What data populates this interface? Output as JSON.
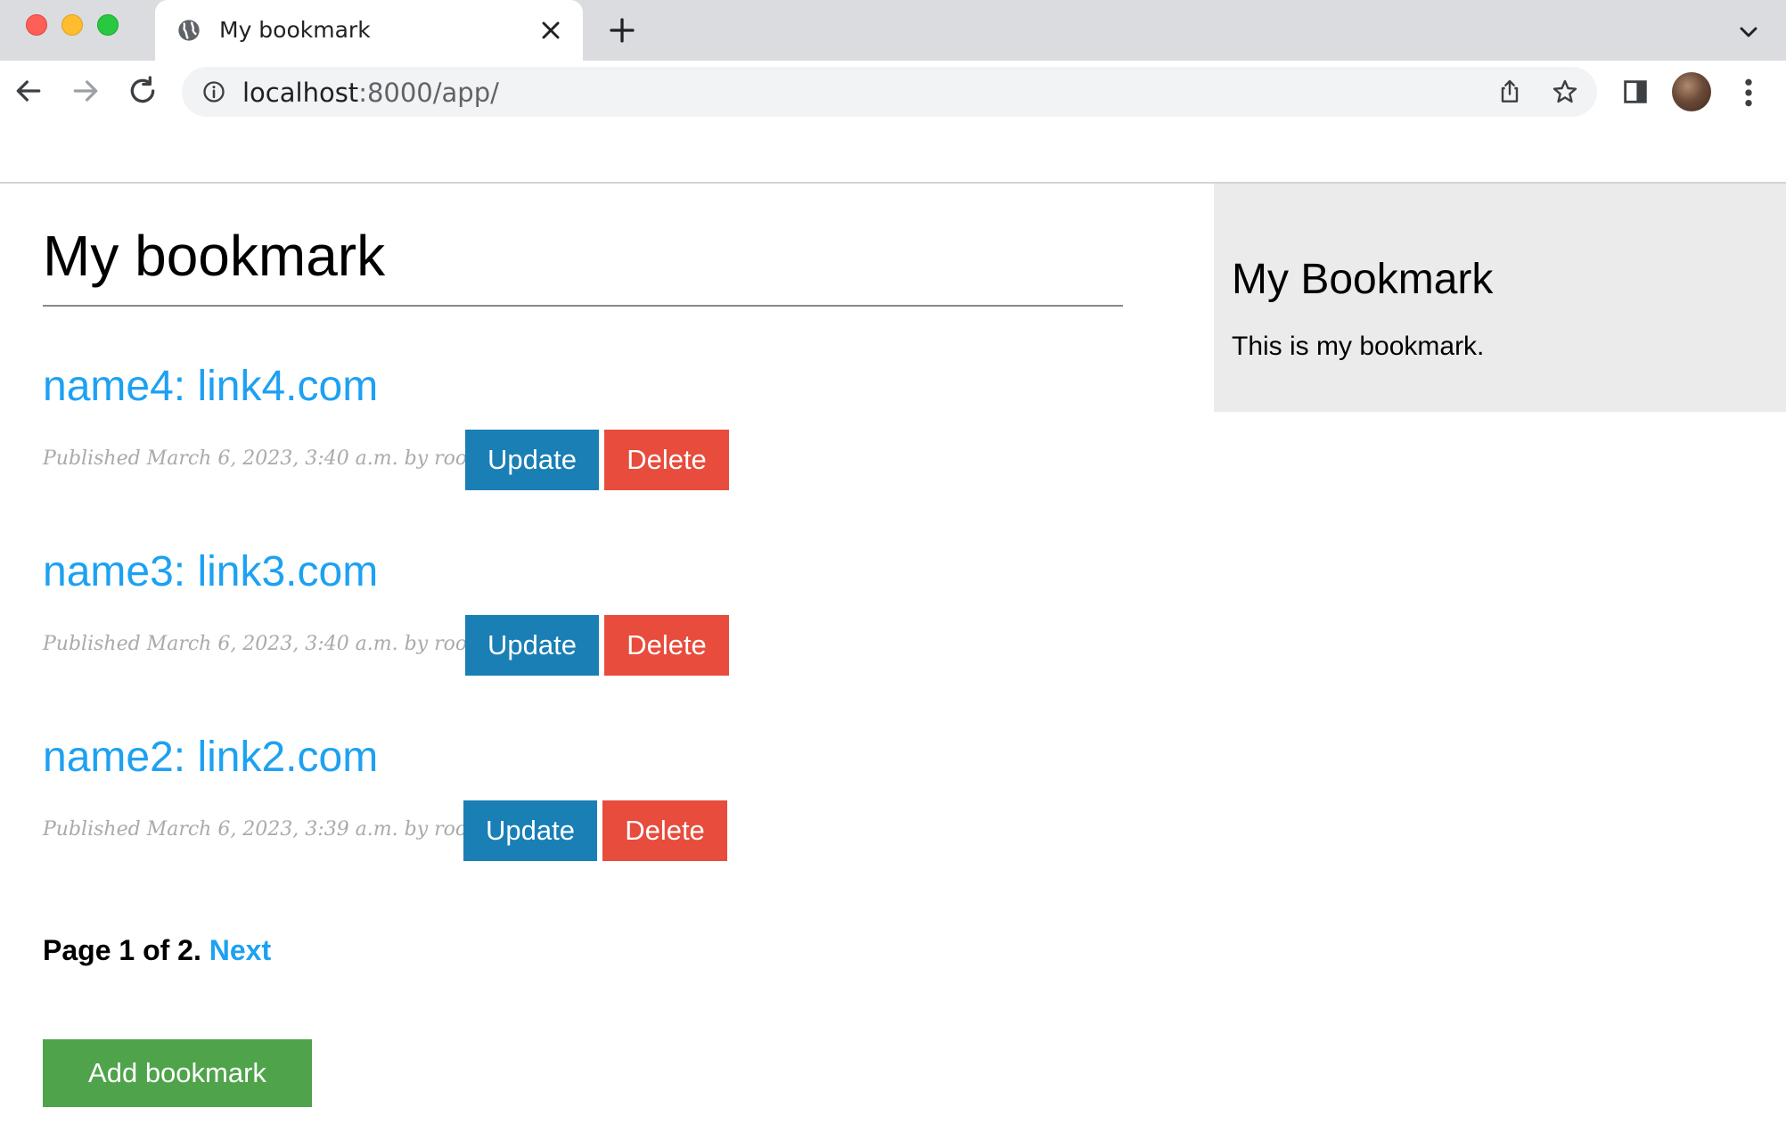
{
  "browser": {
    "tab_title": "My bookmark",
    "url_host": "localhost",
    "url_rest": ":8000/app/",
    "icons": {
      "favicon": "globe-icon",
      "tab_close": "close-icon",
      "new_tab": "plus-icon",
      "tab_search": "chevron-down-icon",
      "back": "arrow-left-icon",
      "forward": "arrow-right-icon",
      "reload": "reload-icon",
      "site_info": "info-icon",
      "share": "share-icon",
      "bookmark": "star-icon",
      "side_panel": "side-panel-icon",
      "menu": "kebab-menu-icon"
    }
  },
  "page": {
    "title": "My bookmark",
    "entries": [
      {
        "title": "name4: link4.com",
        "meta": "Published March 6, 2023, 3:40 a.m. by root",
        "update_label": "Update",
        "delete_label": "Delete"
      },
      {
        "title": "name3: link3.com",
        "meta": "Published March 6, 2023, 3:40 a.m. by root",
        "update_label": "Update",
        "delete_label": "Delete"
      },
      {
        "title": "name2: link2.com",
        "meta": "Published March 6, 2023, 3:39 a.m. by root",
        "update_label": "Update",
        "delete_label": "Delete"
      }
    ],
    "pagination": {
      "text": "Page 1 of 2.",
      "next_label": "Next"
    },
    "add_label": "Add bookmark"
  },
  "sidebar": {
    "title": "My Bookmark",
    "text": "This is my bookmark."
  },
  "colors": {
    "link": "#1da1f2",
    "update_button": "#1a7fb5",
    "delete_button": "#e74c3c",
    "add_button": "#4fa34b",
    "sidebar_bg": "#ebebeb"
  }
}
